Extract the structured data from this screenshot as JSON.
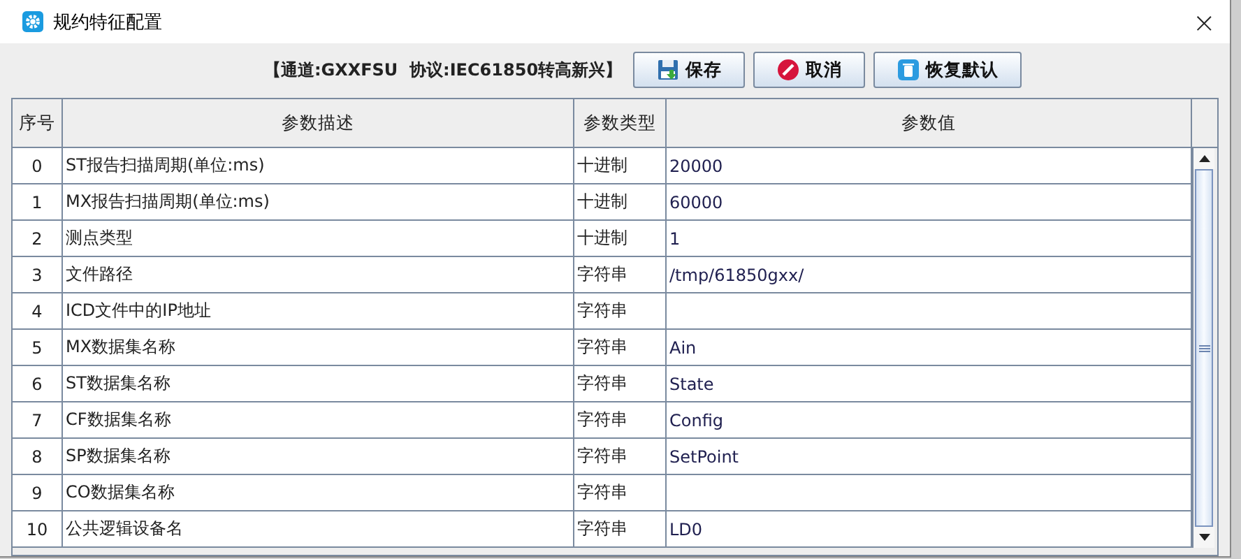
{
  "window": {
    "title": "规约特征配置",
    "close": "×"
  },
  "toolbar": {
    "info": "【通道:GXXFSU  协议:IEC61850转高新兴】",
    "buttons": [
      {
        "kind": "save",
        "label": "保存"
      },
      {
        "kind": "cancel",
        "label": "取消"
      },
      {
        "kind": "restore",
        "label": "恢复默认"
      }
    ]
  },
  "table": {
    "columns": [
      "序号",
      "参数描述",
      "参数类型",
      "参数值"
    ],
    "rows": [
      {
        "index": "0",
        "description": "ST报告扫描周期(单位:ms)",
        "type": "十进制",
        "value": "20000"
      },
      {
        "index": "1",
        "description": "MX报告扫描周期(单位:ms)",
        "type": "十进制",
        "value": "60000"
      },
      {
        "index": "2",
        "description": "测点类型",
        "type": "十进制",
        "value": "1"
      },
      {
        "index": "3",
        "description": "文件路径",
        "type": "字符串",
        "value": "/tmp/61850gxx/"
      },
      {
        "index": "4",
        "description": "ICD文件中的IP地址",
        "type": "字符串"
      },
      {
        "index": "5",
        "description": "MX数据集名称",
        "type": "字符串",
        "value": "Ain"
      },
      {
        "index": "6",
        "description": "ST数据集名称",
        "type": "字符串",
        "value": "State"
      },
      {
        "index": "7",
        "description": "CF数据集名称",
        "type": "字符串",
        "value": "Config"
      },
      {
        "index": "8",
        "description": "SP数据集名称",
        "type": "字符串",
        "value": "SetPoint"
      },
      {
        "index": "9",
        "description": "CO数据集名称",
        "type": "字符串"
      },
      {
        "index": "10",
        "description": "公共逻辑设备名",
        "type": "字符串",
        "value": "LD0"
      }
    ]
  }
}
